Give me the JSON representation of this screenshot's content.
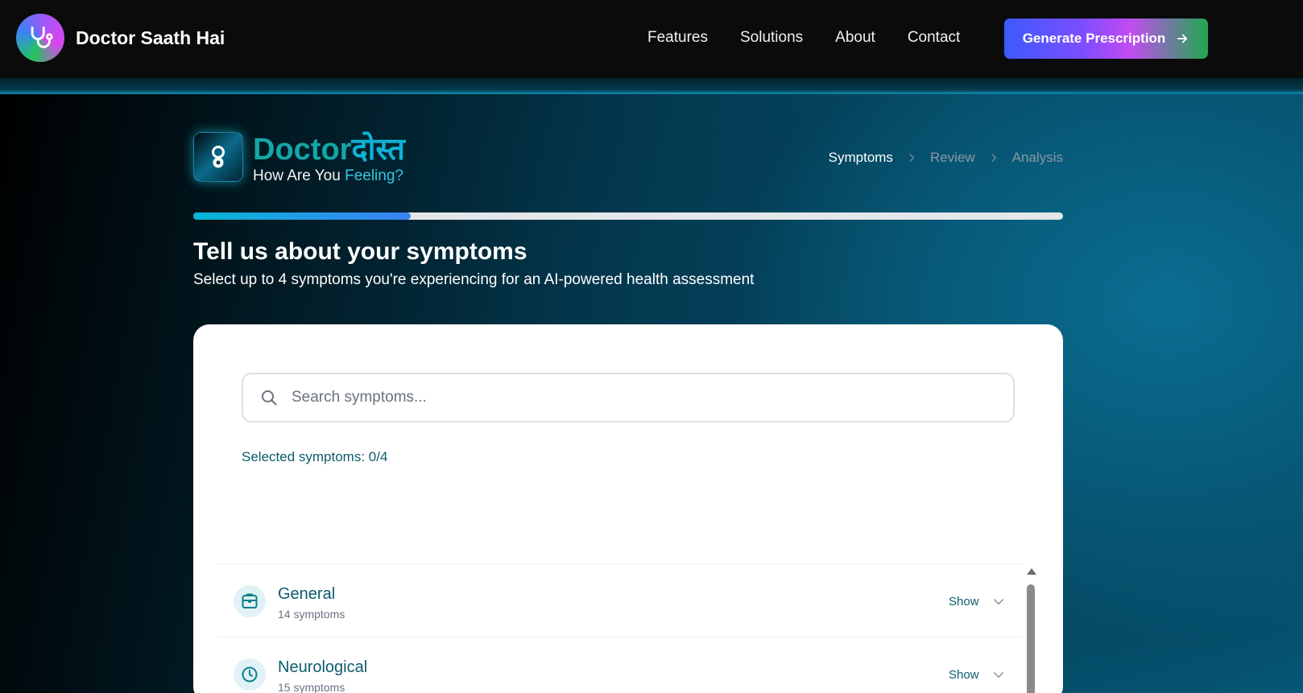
{
  "nav": {
    "brand": "Doctor Saath Hai",
    "links": [
      "Features",
      "Solutions",
      "About",
      "Contact"
    ],
    "cta_label": "Generate Prescription"
  },
  "app": {
    "title_part1": "Doctor",
    "title_part2": "दोस्त",
    "subtitle_part1": "How Are You ",
    "subtitle_part2": "Feeling?"
  },
  "steps": [
    {
      "label": "Symptoms",
      "active": true
    },
    {
      "label": "Review",
      "active": false
    },
    {
      "label": "Analysis",
      "active": false
    }
  ],
  "progress": {
    "value": 0.25
  },
  "page": {
    "heading": "Tell us about your symptoms",
    "subheading": "Select up to 4 symptoms you're experiencing for an AI-powered health assessment"
  },
  "search": {
    "placeholder": "Search symptoms...",
    "value": ""
  },
  "selection": {
    "label": "Selected symptoms: 0/4"
  },
  "categories": [
    {
      "name": "General",
      "count": "14 symptoms",
      "action": "Show",
      "icon": "box-icon"
    },
    {
      "name": "Neurological",
      "count": "15 symptoms",
      "action": "Show",
      "icon": "clock-icon"
    }
  ],
  "colors": {
    "accent_teal": "#14a6a6",
    "accent_cyan": "#0fb2d6",
    "text_dark_teal": "#0d5c6e",
    "progress_start": "#06b6d4",
    "progress_end": "#3b82f6"
  }
}
